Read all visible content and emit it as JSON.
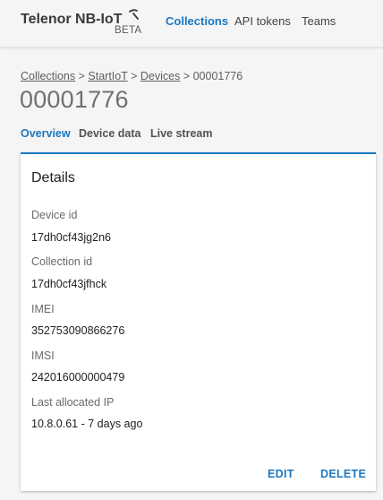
{
  "header": {
    "brand": "Telenor NB-IoT",
    "badge": "BETA",
    "nav": {
      "collections": "Collections",
      "api_tokens": "API tokens",
      "teams": "Teams"
    }
  },
  "breadcrumb": {
    "collections": "Collections",
    "sep1": " > ",
    "collection": "StartIoT",
    "sep2": " > ",
    "devices": "Devices",
    "sep3": " > ",
    "current": "00001776"
  },
  "page": {
    "title": "00001776"
  },
  "tabs": {
    "overview": "Overview",
    "device_data": "Device data",
    "live_stream": "Live stream"
  },
  "details": {
    "title": "Details",
    "fields": [
      {
        "label": "Device id",
        "value": "17dh0cf43jg2n6"
      },
      {
        "label": "Collection id",
        "value": "17dh0cf43jfhck"
      },
      {
        "label": "IMEI",
        "value": "352753090866276"
      },
      {
        "label": "IMSI",
        "value": "242016000000479"
      },
      {
        "label": "Last allocated IP",
        "value": "10.8.0.61 - 7 days ago"
      }
    ],
    "actions": {
      "edit": "EDIT",
      "delete": "DELETE"
    }
  },
  "colors": {
    "accent": "#1a78c2",
    "background": "#f5f5f5",
    "card": "#ffffff"
  }
}
